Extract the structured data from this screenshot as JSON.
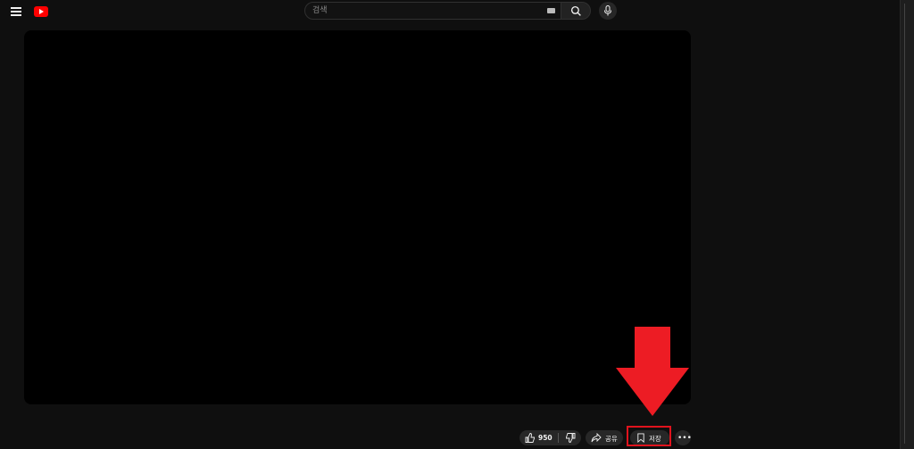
{
  "header": {
    "search": {
      "placeholder": "검색"
    }
  },
  "actions": {
    "like_count": "950",
    "share_label": "공유",
    "save_label": "저장",
    "more_symbol": "•••"
  },
  "colors": {
    "background": "#0f0f0f",
    "player": "#000000",
    "pill": "#272727",
    "brand": "#ff0000",
    "annotation": "#e0131d"
  }
}
